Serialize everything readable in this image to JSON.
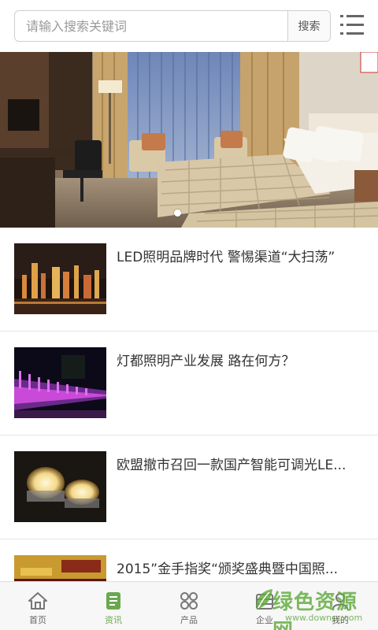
{
  "header": {
    "search_placeholder": "请输入搜索关键词",
    "search_button_label": "搜索"
  },
  "banner": {
    "slide_count": 1,
    "active_slide": 1
  },
  "news": [
    {
      "title": "LED照明品牌时代 警惕渠道“大扫荡”"
    },
    {
      "title": "灯都照明产业发展 路在何方？"
    },
    {
      "title": "欧盟撤市召回一款国产智能可调光LE..."
    },
    {
      "title": "2015”金手指奖“颁奖盛典暨中国照..."
    }
  ],
  "bottom_nav": [
    {
      "label": "首页",
      "icon": "home-icon"
    },
    {
      "label": "资讯",
      "icon": "news-icon"
    },
    {
      "label": "产品",
      "icon": "grid-icon"
    },
    {
      "label": "企业",
      "icon": "company-icon"
    },
    {
      "label": "我的",
      "icon": "user-icon"
    }
  ],
  "colors": {
    "accent_green": "#6aa84f",
    "watermark_green": "#5faa3c"
  },
  "watermark": {
    "title": "绿色资源网",
    "url": "www.downcc.com"
  }
}
